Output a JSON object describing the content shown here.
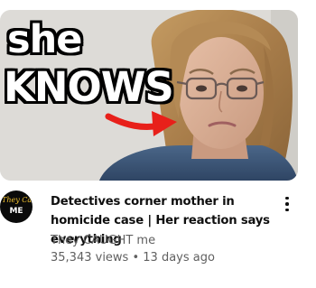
{
  "video": {
    "thumbnail": {
      "overlay_line1": "she",
      "overlay_line2": "KNOWS",
      "arrow_color": "#e8201a"
    },
    "channel_avatar": {
      "line1": "They Caught",
      "line2": "ME"
    },
    "title": "Detectives corner mother in homicide case | Her reaction says everything",
    "channel_name": "They CAUGHT me",
    "views": "35,343 views",
    "separator": "•",
    "age": "13 days ago",
    "menu_icon": "more-vert-icon"
  },
  "colors": {
    "title": "#0f0f0f",
    "secondary_text": "#606060",
    "avatar_accent": "#f2c230"
  }
}
